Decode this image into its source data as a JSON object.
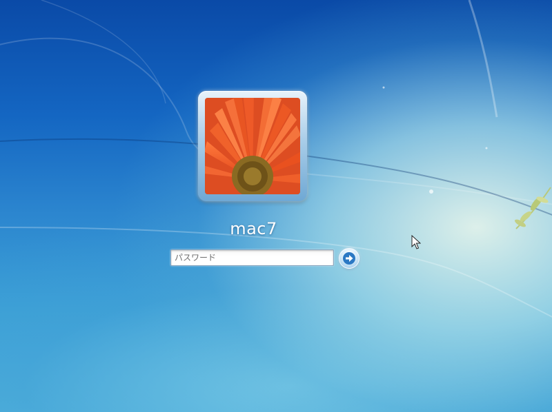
{
  "login": {
    "username": "mac7",
    "password_placeholder": "パスワード",
    "password_value": ""
  },
  "icons": {
    "submit": "arrow-right-icon",
    "cursor": "mouse-pointer-icon",
    "avatar": "flower-avatar"
  },
  "colors": {
    "background_top": "#0a4aa7",
    "background_glow": "#e6f5eb",
    "flower_petals": "#ee5a28",
    "flower_center": "#8a6a22",
    "submit_arrow": "#2b78c4"
  }
}
